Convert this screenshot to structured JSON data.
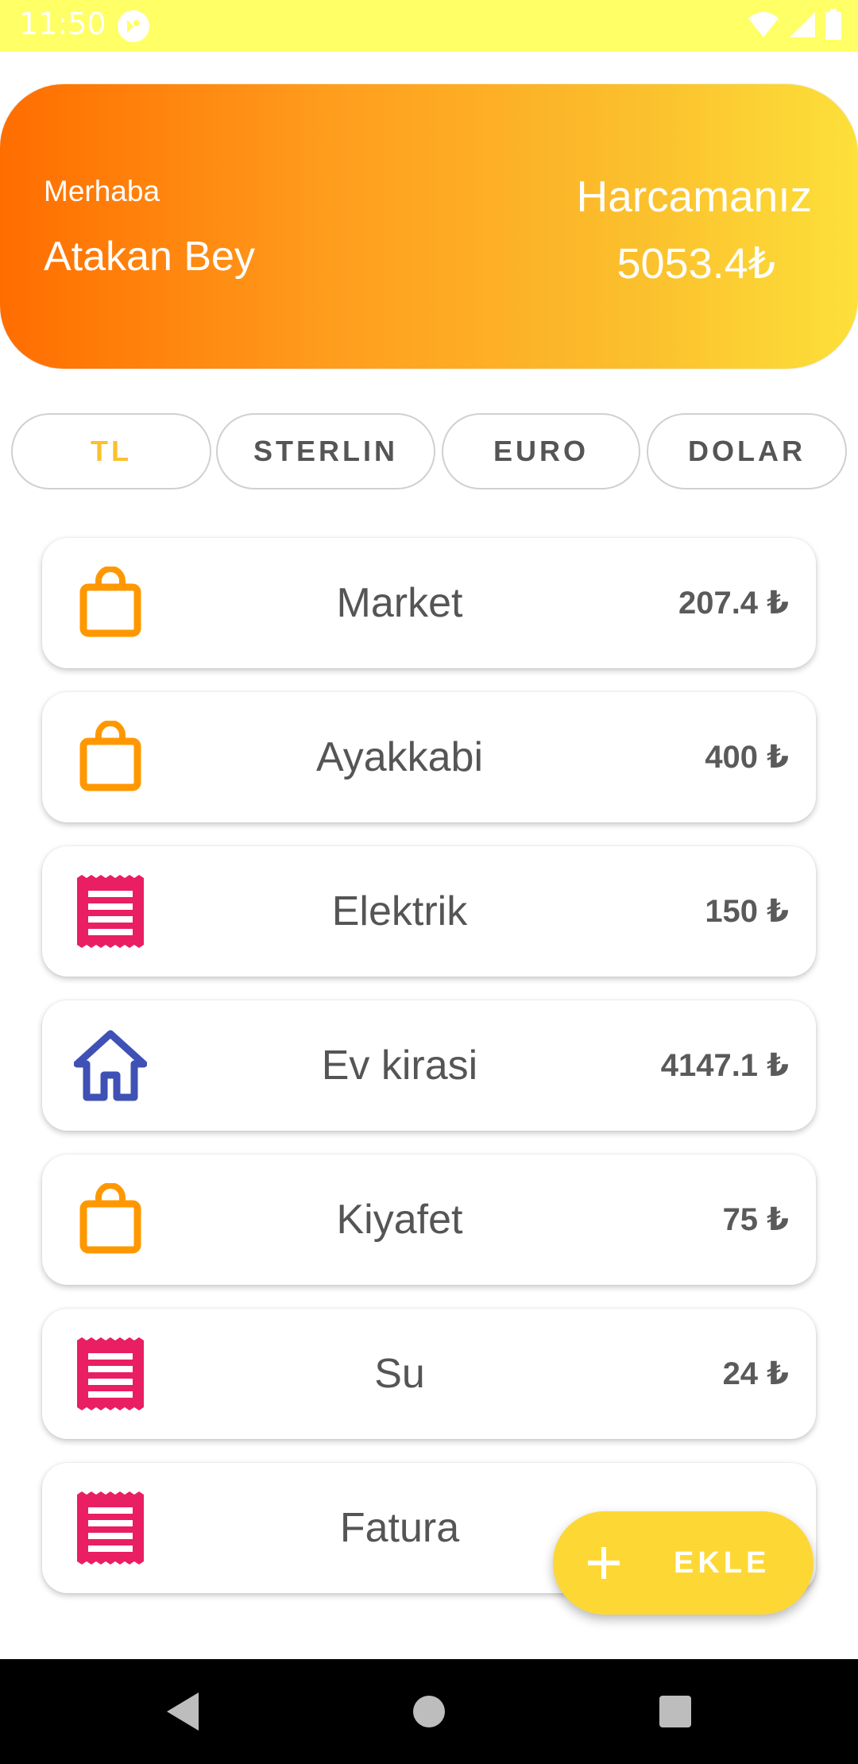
{
  "status_bar": {
    "time": "11:50",
    "icons": [
      "app-notification-icon",
      "wifi-icon",
      "cellular-signal-icon",
      "battery-icon"
    ]
  },
  "header": {
    "greeting": "Merhaba",
    "user_name": "Atakan Bey",
    "spend_title": "Harcamanız",
    "spend_total": "5053.4₺",
    "gradient_colors": [
      "#ff6d00",
      "#fde03a"
    ]
  },
  "currencies": [
    {
      "label": "TL",
      "selected": true
    },
    {
      "label": "STERLIN",
      "selected": false
    },
    {
      "label": "EURO",
      "selected": false
    },
    {
      "label": "DOLAR",
      "selected": false
    }
  ],
  "expenses": [
    {
      "name": "Market",
      "amount": "207.4 ₺",
      "icon": "shopping-bag-icon",
      "icon_color": "#ff9800"
    },
    {
      "name": "Ayakkabi",
      "amount": "400 ₺",
      "icon": "shopping-bag-icon",
      "icon_color": "#ff9800"
    },
    {
      "name": "Elektrik",
      "amount": "150 ₺",
      "icon": "receipt-icon",
      "icon_color": "#e91e63"
    },
    {
      "name": "Ev kirasi",
      "amount": "4147.1 ₺",
      "icon": "home-icon",
      "icon_color": "#3f51b5"
    },
    {
      "name": "Kiyafet",
      "amount": "75 ₺",
      "icon": "shopping-bag-icon",
      "icon_color": "#ff9800"
    },
    {
      "name": "Su",
      "amount": "24 ₺",
      "icon": "receipt-icon",
      "icon_color": "#e91e63"
    },
    {
      "name": "Fatura",
      "amount": "",
      "icon": "receipt-icon",
      "icon_color": "#e91e63"
    }
  ],
  "fab": {
    "label": "EKLE",
    "icon": "plus-icon",
    "color": "#fdd835"
  },
  "nav": {
    "buttons": [
      "back-icon",
      "home-icon",
      "recents-icon"
    ]
  },
  "colors": {
    "status_bar": "#ffff66",
    "accent": "#fbc02d",
    "text_gray": "#555555"
  }
}
